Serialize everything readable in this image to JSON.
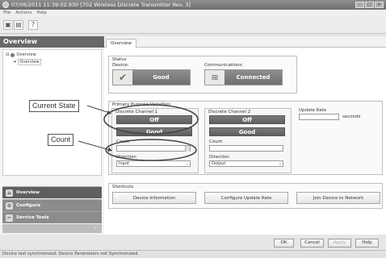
{
  "window": {
    "title": "07/06/2011 11:39:02.930 [702 Wireless Discrete Transmitter Rev. 3]",
    "controls": [
      "-",
      "□",
      "×"
    ]
  },
  "menu": [
    "File",
    "Actions",
    "Help"
  ],
  "toolbar": {
    "icons": [
      "save-icon",
      "device-icon",
      "help-icon"
    ]
  },
  "left_panel": {
    "header": "Overview",
    "tree": [
      {
        "label": "Overview",
        "expander": "⊟"
      },
      {
        "label": "Overview"
      }
    ],
    "nav": [
      {
        "label": "Overview",
        "icon": "home-icon",
        "selected": true
      },
      {
        "label": "Configure",
        "icon": "configure-icon",
        "selected": false
      },
      {
        "label": "Service Tools",
        "icon": "tools-icon",
        "selected": false
      }
    ]
  },
  "main": {
    "tab": "Overview",
    "status": {
      "title": "Status",
      "device_label": "Device:",
      "device_value": "Good",
      "comm_label": "Communications:",
      "comm_value": "Connected"
    },
    "primary_group": {
      "title": "Primary Purpose Variables",
      "channels": [
        {
          "label": "Discrete Channel 1",
          "state": "Off",
          "quality": "Good",
          "count_label": "Count",
          "count_value": "",
          "direction_label": "Direction",
          "direction_value": "Input"
        },
        {
          "label": "Discrete Channel 2",
          "state": "Off",
          "quality": "Good",
          "count_label": "Count",
          "count_value": "",
          "direction_label": "Direction",
          "direction_value": "Output"
        }
      ],
      "update_rate_label": "Update Rate",
      "update_rate_value": "",
      "update_rate_units": "seconds"
    },
    "shortcuts": {
      "title": "Shortcuts",
      "buttons": [
        "Device Information",
        "Configure Update Rate",
        "Join Device to Network"
      ]
    }
  },
  "footer_buttons": [
    {
      "label": "OK",
      "enabled": true
    },
    {
      "label": "Cancel",
      "enabled": true
    },
    {
      "label": "Apply",
      "enabled": false
    },
    {
      "label": "Help",
      "enabled": true
    }
  ],
  "statusbar": "Device last synchronized: Device Parameters not Synchronized.",
  "annotations": [
    {
      "label": "Current State"
    },
    {
      "label": "Count"
    }
  ]
}
